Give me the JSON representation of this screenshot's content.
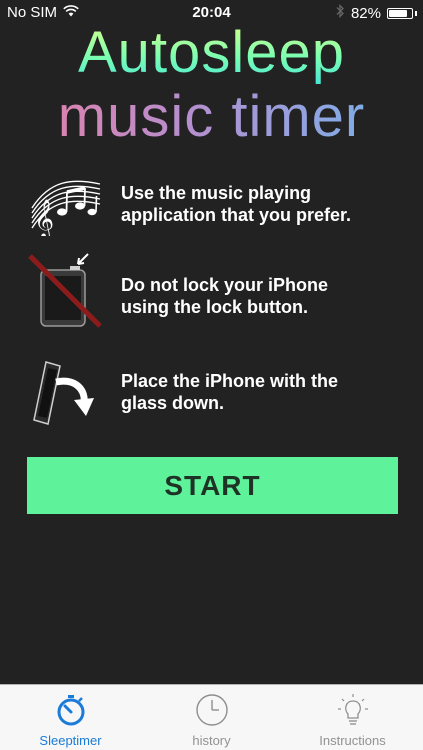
{
  "status_bar": {
    "carrier": "No SIM",
    "time": "20:04",
    "battery": "82%",
    "battery_level": 0.82
  },
  "title": {
    "line1": "Autosleep",
    "line2": "music timer"
  },
  "instructions": [
    {
      "icon": "music-notes-icon",
      "text": "Use the music playing\napplication that you prefer."
    },
    {
      "icon": "no-lock-iphone-icon",
      "text": "Do not lock your iPhone\nusing the lock button."
    },
    {
      "icon": "phone-flip-icon",
      "text": "Place the iPhone with the\nglass down."
    }
  ],
  "start_button": {
    "label": "START"
  },
  "colors": {
    "accent": "#5ef29a",
    "tab_active": "#1a7bd8",
    "tab_inactive": "#929292"
  },
  "tabs": [
    {
      "label": "Sleeptimer",
      "icon": "stopwatch-icon",
      "active": true
    },
    {
      "label": "history",
      "icon": "clock-icon",
      "active": false
    },
    {
      "label": "Instructions",
      "icon": "lightbulb-icon",
      "active": false
    }
  ]
}
